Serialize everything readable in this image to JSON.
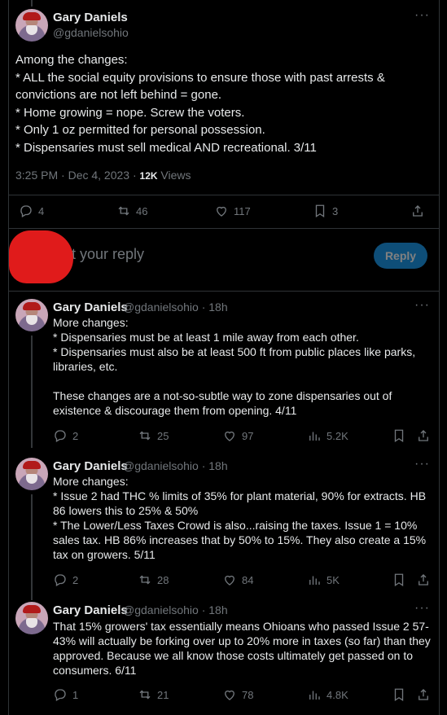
{
  "main_tweet": {
    "name": "Gary Daniels",
    "handle": "@gdanielsohio",
    "text": "Among the changes:\n* ALL the social equity provisions to ensure those with past arrests &\nconvictions are not left behind = gone.\n* Home growing = nope. Screw the voters.\n* Only 1 oz permitted for personal possession.\n* Dispensaries must sell medical AND recreational. 3/11",
    "time": "3:25 PM · Dec 4, 2023 · ",
    "views_count": "12K",
    "views_label": " Views",
    "replies": "4",
    "reposts": "46",
    "likes": "117",
    "bookmarks": "3"
  },
  "reply_box": {
    "placeholder_visible": "st your reply",
    "button": "Reply"
  },
  "replies": [
    {
      "name": "Gary Daniels",
      "handle": "@gdanielsohio · 18h",
      "text": "More changes:\n* Dispensaries must be at least 1 mile away from each other.\n* Dispensaries must also be at least 500 ft from public places like parks,\nlibraries, etc.\n\nThese changes are a not-so-subtle way to zone dispensaries out of\nexistence & discourage them from opening. 4/11",
      "replies": "2",
      "reposts": "25",
      "likes": "97",
      "views": "5.2K"
    },
    {
      "name": "Gary Daniels",
      "handle": "@gdanielsohio · 18h",
      "text": "More changes:\n* Issue 2 had THC % limits of 35% for plant material, 90% for extracts. HB\n86 lowers this to 25% & 50%\n* The Lower/Less Taxes Crowd is also...raising the taxes. Issue 1 = 10%\nsales tax. HB 86% increases that by 50% to 15%. They also create a 15%\ntax on growers. 5/11",
      "replies": "2",
      "reposts": "28",
      "likes": "84",
      "views": "5K"
    },
    {
      "name": "Gary Daniels",
      "handle": "@gdanielsohio · 18h",
      "text": "That 15% growers' tax essentially means Ohioans who passed Issue 2 57-\n43% will actually be forking over up to 20% more in taxes (so far) than they\napproved. Because we all know those costs ultimately get passed on to\nconsumers. 6/11",
      "replies": "1",
      "reposts": "21",
      "likes": "78",
      "views": "4.8K"
    }
  ],
  "colors": {
    "accent": "#1d9bf0",
    "background": "#000000",
    "muted": "#71767b",
    "redaction": "#e01b1b"
  }
}
